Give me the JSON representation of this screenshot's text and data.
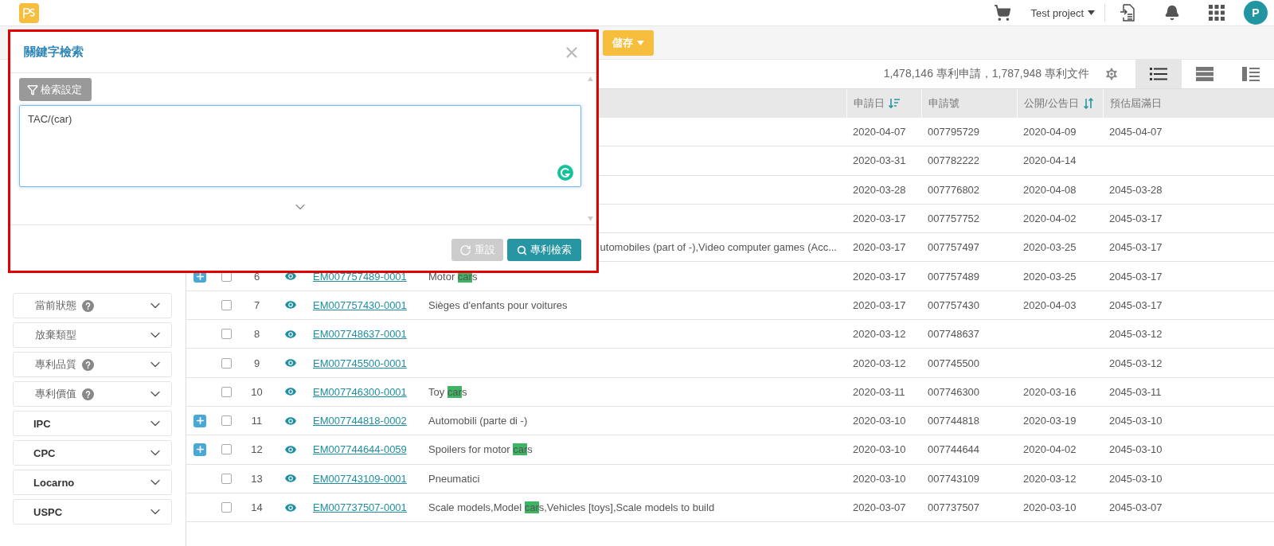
{
  "header": {
    "project": "Test project",
    "avatar": "P"
  },
  "toolbar": {
    "save_button": "儲存"
  },
  "results": {
    "summary": "1,478,146 專利申請，1,787,948 專利文件",
    "views": [
      {
        "kind": "list",
        "selected": true
      },
      {
        "kind": "rows",
        "selected": false
      },
      {
        "kind": "split",
        "selected": false
      }
    ]
  },
  "filters": [
    {
      "label": "當前狀態",
      "help": true,
      "emphasis": false
    },
    {
      "label": "放棄類型",
      "help": false,
      "emphasis": false
    },
    {
      "label": "專利品質",
      "help": true,
      "emphasis": false
    },
    {
      "label": "專利價值",
      "help": true,
      "emphasis": false
    },
    {
      "label": "IPC",
      "help": false,
      "emphasis": true
    },
    {
      "label": "CPC",
      "help": false,
      "emphasis": true
    },
    {
      "label": "Locarno",
      "help": false,
      "emphasis": true
    },
    {
      "label": "USPC",
      "help": false,
      "emphasis": true
    }
  ],
  "table": {
    "columns": [
      {
        "label": "申請日",
        "sort": {
          "kind": "desc"
        }
      },
      {
        "label": "申請號"
      },
      {
        "label": "公開/公告日",
        "sort": {
          "kind": "both"
        }
      },
      {
        "label": "預估屆滿日"
      }
    ],
    "rows": [
      {
        "cells": [
          "2020-04-07",
          "007795729",
          "2020-04-09",
          "2045-04-07"
        ]
      },
      {
        "cells": [
          "2020-03-31",
          "007782222",
          "2020-04-14",
          ""
        ]
      },
      {
        "cells": [
          "2020-03-28",
          "007776802",
          "2020-04-08",
          "2045-03-28"
        ]
      },
      {
        "cells": [
          "2020-03-17",
          "007757752",
          "2020-04-02",
          "2045-03-17"
        ]
      },
      {
        "description": [
          {
            "text": "utomobiles (part of -),Video computer games (Acc..."
          }
        ],
        "clipped": true,
        "cells": [
          "2020-03-17",
          "007757497",
          "2020-03-25",
          "2045-03-17"
        ]
      },
      {
        "expandable": true,
        "checked": false,
        "number": "6",
        "link": "EM007757489-0001",
        "description": [
          {
            "text": "Motor "
          },
          {
            "text": "car",
            "highlight": true
          },
          {
            "text": "s"
          }
        ],
        "cells": [
          "2020-03-17",
          "007757489",
          "2020-03-25",
          "2045-03-17"
        ]
      },
      {
        "expandable": false,
        "checked": false,
        "number": "7",
        "link": "EM007757430-0001",
        "description": [
          {
            "text": "Sièges d'enfants pour voitures"
          }
        ],
        "cells": [
          "2020-03-17",
          "007757430",
          "2020-04-03",
          "2045-03-17"
        ]
      },
      {
        "expandable": false,
        "checked": false,
        "number": "8",
        "link": "EM007748637-0001",
        "cells": [
          "2020-03-12",
          "007748637",
          "",
          "2045-03-12"
        ]
      },
      {
        "expandable": false,
        "checked": false,
        "number": "9",
        "link": "EM007745500-0001",
        "cells": [
          "2020-03-12",
          "007745500",
          "",
          "2045-03-12"
        ]
      },
      {
        "expandable": false,
        "checked": false,
        "number": "10",
        "link": "EM007746300-0001",
        "description": [
          {
            "text": "Toy "
          },
          {
            "text": "car",
            "highlight": true
          },
          {
            "text": "s"
          }
        ],
        "cells": [
          "2020-03-11",
          "007746300",
          "2020-03-16",
          "2045-03-11"
        ]
      },
      {
        "expandable": true,
        "checked": false,
        "number": "11",
        "link": "EM007744818-0002",
        "description": [
          {
            "text": "Automobili (parte di -)"
          }
        ],
        "cells": [
          "2020-03-10",
          "007744818",
          "2020-03-19",
          "2045-03-10"
        ]
      },
      {
        "expandable": true,
        "checked": false,
        "number": "12",
        "link": "EM007744644-0059",
        "description": [
          {
            "text": "Spoilers for motor "
          },
          {
            "text": "car",
            "highlight": true
          },
          {
            "text": "s"
          }
        ],
        "cells": [
          "2020-03-10",
          "007744644",
          "2020-04-02",
          "2045-03-10"
        ]
      },
      {
        "expandable": false,
        "checked": false,
        "number": "13",
        "link": "EM007743109-0001",
        "description": [
          {
            "text": "Pneumatici"
          }
        ],
        "cells": [
          "2020-03-10",
          "007743109",
          "2020-03-12",
          "2045-03-10"
        ]
      },
      {
        "expandable": false,
        "checked": false,
        "number": "14",
        "link": "EM007737507-0001",
        "description": [
          {
            "text": "Scale models,Model "
          },
          {
            "text": "car",
            "highlight": true
          },
          {
            "text": "s,Vehicles [toys],Scale models to build"
          }
        ],
        "cells": [
          "2020-03-07",
          "007737507",
          "2020-03-10",
          "2045-03-07"
        ]
      }
    ]
  },
  "modal": {
    "title": "關鍵字檢索",
    "settings_button": "檢索設定",
    "query": "TAC/(car)",
    "reset_button": {
      "label": "重設",
      "disabled": true
    },
    "search_button": "專利檢索"
  }
}
